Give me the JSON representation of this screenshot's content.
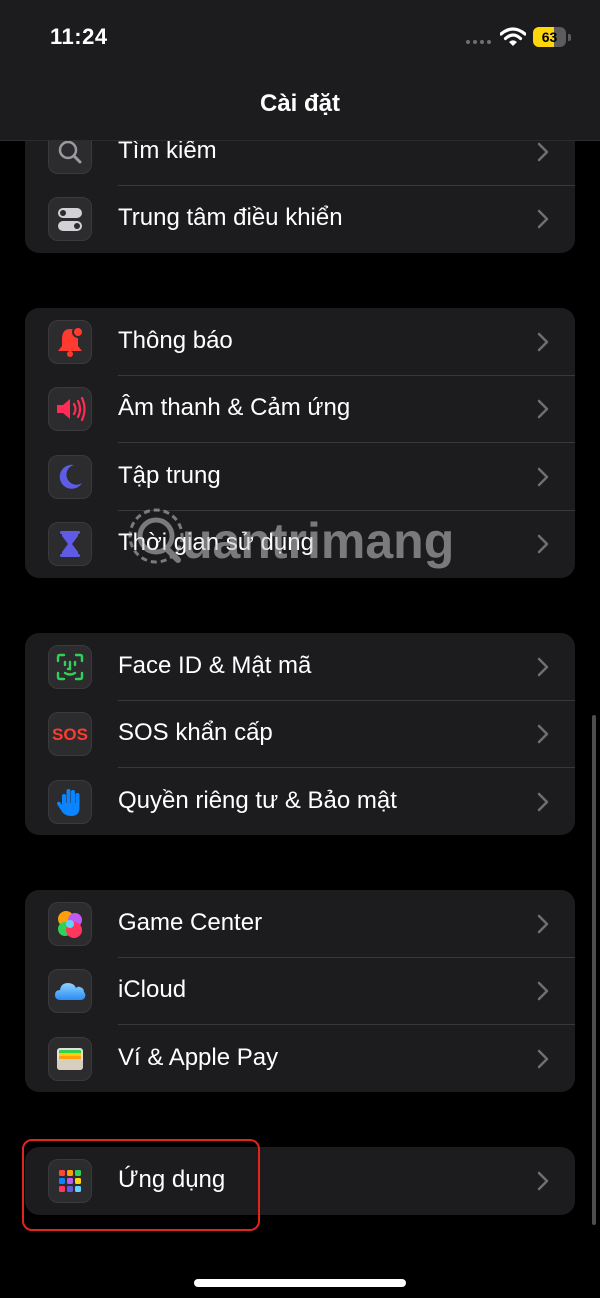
{
  "status_bar": {
    "time": "11:24",
    "battery_percent": "63",
    "battery_level": 0.63
  },
  "nav": {
    "title": "Cài đặt"
  },
  "groups": [
    {
      "rows": [
        {
          "label": "Tìm kiếm",
          "icon": "magnifier-icon"
        },
        {
          "label": "Trung tâm điều khiển",
          "icon": "toggles-icon"
        }
      ]
    },
    {
      "rows": [
        {
          "label": "Thông báo",
          "icon": "bell-icon"
        },
        {
          "label": "Âm thanh & Cảm ứng",
          "icon": "speaker-icon"
        },
        {
          "label": "Tập trung",
          "icon": "moon-icon"
        },
        {
          "label": "Thời gian sử dụng",
          "icon": "hourglass-icon"
        }
      ]
    },
    {
      "rows": [
        {
          "label": "Face ID & Mật mã",
          "icon": "face-id-icon"
        },
        {
          "label": "SOS khẩn cấp",
          "icon": "sos-icon",
          "icon_text": "SOS"
        },
        {
          "label": "Quyền riêng tư & Bảo mật",
          "icon": "hand-icon"
        }
      ]
    },
    {
      "rows": [
        {
          "label": "Game Center",
          "icon": "game-center-icon"
        },
        {
          "label": "iCloud",
          "icon": "cloud-icon"
        },
        {
          "label": "Ví & Apple Pay",
          "icon": "wallet-icon"
        }
      ]
    },
    {
      "rows": [
        {
          "label": "Ứng dụng",
          "icon": "app-grid-icon"
        }
      ]
    }
  ],
  "watermark": {
    "text": "uantrimang"
  },
  "colors": {
    "background": "#000000",
    "group_background": "#1c1c1e",
    "separator": "#38383a",
    "chevron": "#6e6e73",
    "highlight": "#e1251b",
    "battery_fill": "#ffd60a"
  }
}
